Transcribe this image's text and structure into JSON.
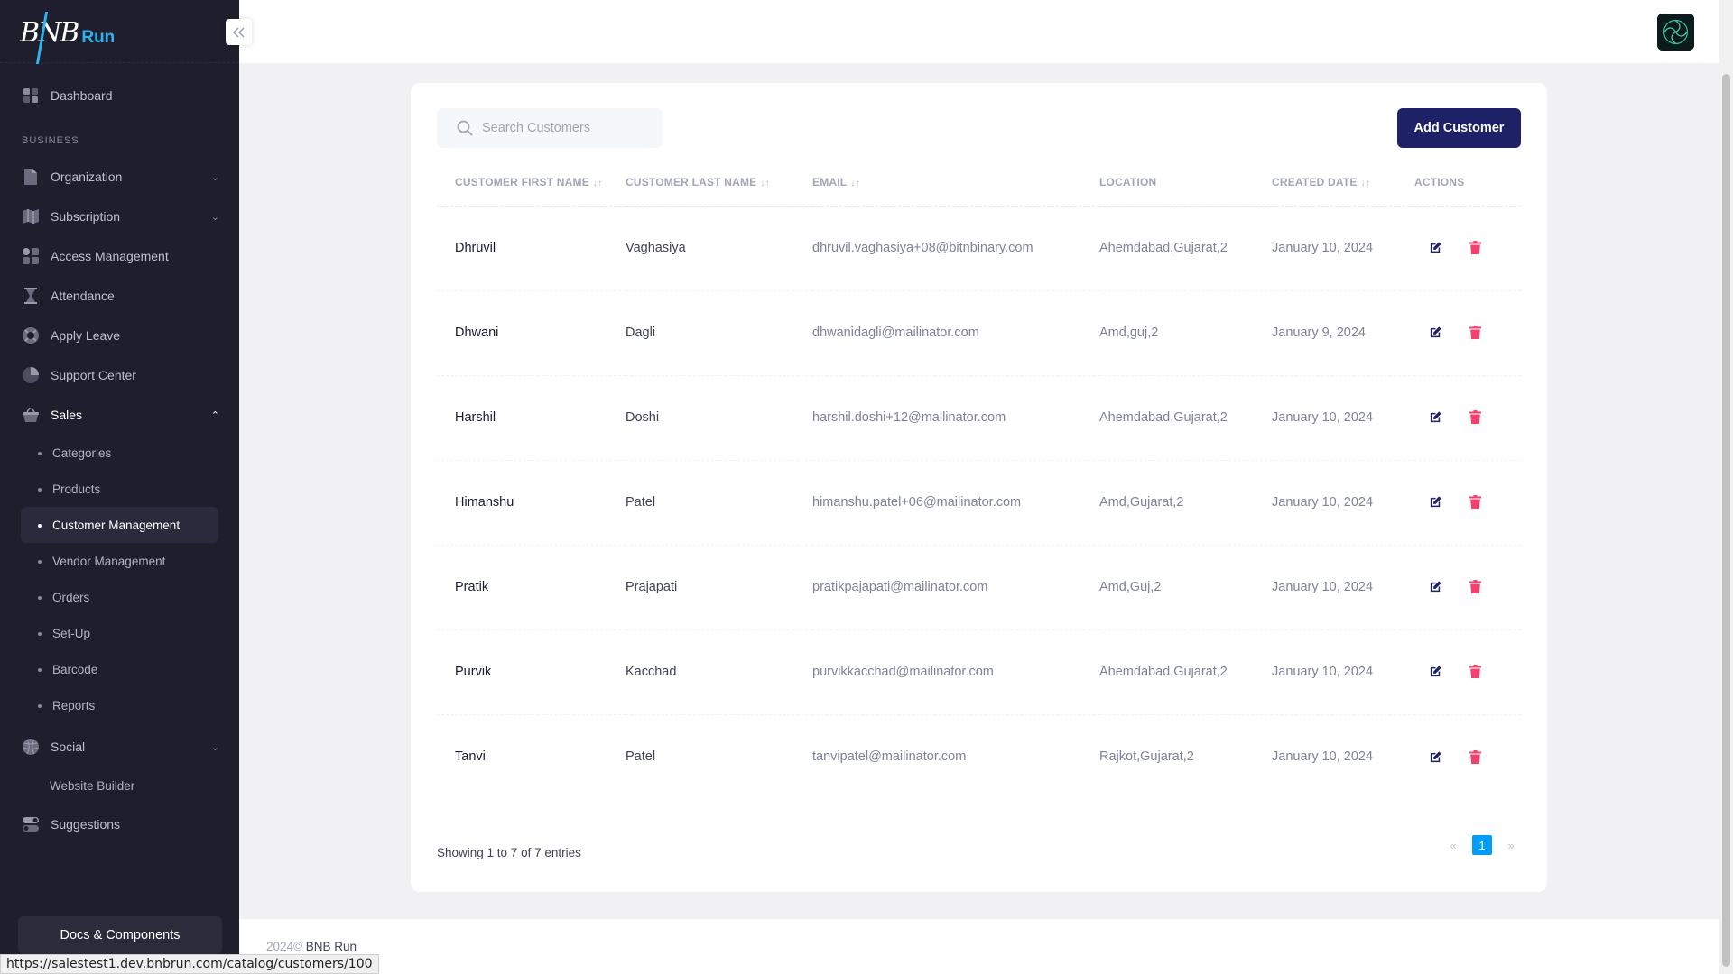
{
  "brand": {
    "logo_text": "BNB",
    "logo_run": "Run"
  },
  "sidebar": {
    "dashboard": "Dashboard",
    "section_label": "BUSINESS",
    "items": [
      {
        "label": "Organization",
        "icon": "document-icon",
        "expandable": true
      },
      {
        "label": "Subscription",
        "icon": "map-icon",
        "expandable": true
      },
      {
        "label": "Access Management",
        "icon": "apps-icon",
        "expandable": false
      },
      {
        "label": "Attendance",
        "icon": "hourglass-icon",
        "expandable": false
      },
      {
        "label": "Apply Leave",
        "icon": "lifebuoy-icon",
        "expandable": false
      },
      {
        "label": "Support Center",
        "icon": "chart-pie-icon",
        "expandable": false
      }
    ],
    "sales": {
      "label": "Sales",
      "sub_items": [
        "Categories",
        "Products",
        "Customer Management",
        "Vendor Management",
        "Orders",
        "Set-Up",
        "Barcode",
        "Reports"
      ],
      "active": "Customer Management"
    },
    "social": {
      "label": "Social",
      "sub": "Website Builder"
    },
    "suggestions": "Suggestions",
    "docs_button": "Docs & Components"
  },
  "toolbar": {
    "search_placeholder": "Search Customers",
    "add_button": "Add Customer"
  },
  "table": {
    "headers": [
      "CUSTOMER FIRST NAME",
      "CUSTOMER LAST NAME",
      "EMAIL",
      "LOCATION",
      "CREATED DATE",
      "ACTIONS"
    ],
    "rows": [
      {
        "first": "Dhruvil",
        "last": "Vaghasiya",
        "email": "dhruvil.vaghasiya+08@bitnbinary.com",
        "location": "Ahemdabad,Gujarat,2",
        "created": "January 10, 2024"
      },
      {
        "first": "Dhwani",
        "last": "Dagli",
        "email": "dhwanidagli@mailinator.com",
        "location": "Amd,guj,2",
        "created": "January 9, 2024"
      },
      {
        "first": "Harshil",
        "last": "Doshi",
        "email": "harshil.doshi+12@mailinator.com",
        "location": "Ahemdabad,Gujarat,2",
        "created": "January 10, 2024"
      },
      {
        "first": "Himanshu",
        "last": "Patel",
        "email": "himanshu.patel+06@mailinator.com",
        "location": "Amd,Gujarat,2",
        "created": "January 10, 2024"
      },
      {
        "first": "Pratik",
        "last": "Prajapati",
        "email": "pratikpajapati@mailinator.com",
        "location": "Amd,Guj,2",
        "created": "January 10, 2024"
      },
      {
        "first": "Purvik",
        "last": "Kacchad",
        "email": "purvikkacchad@mailinator.com",
        "location": "Ahemdabad,Gujarat,2",
        "created": "January 10, 2024"
      },
      {
        "first": "Tanvi",
        "last": "Patel",
        "email": "tanvipatel@mailinator.com",
        "location": "Rajkot,Gujarat,2",
        "created": "January 10, 2024"
      }
    ]
  },
  "footer": {
    "showing": "Showing 1 to 7 of 7 entries",
    "pagination": {
      "prev": "«",
      "current": "1",
      "next": "»"
    },
    "copyright_year": "2024©",
    "copyright_brand": "BNB Run"
  },
  "status_url": "https://salestest1.dev.bnbrun.com/catalog/customers/100",
  "colors": {
    "sidebar_bg": "#1e1e2d",
    "primary_button": "#1e2166",
    "delete_icon": "#f1416c",
    "edit_icon": "#1e2166",
    "accent": "#009ef7"
  }
}
